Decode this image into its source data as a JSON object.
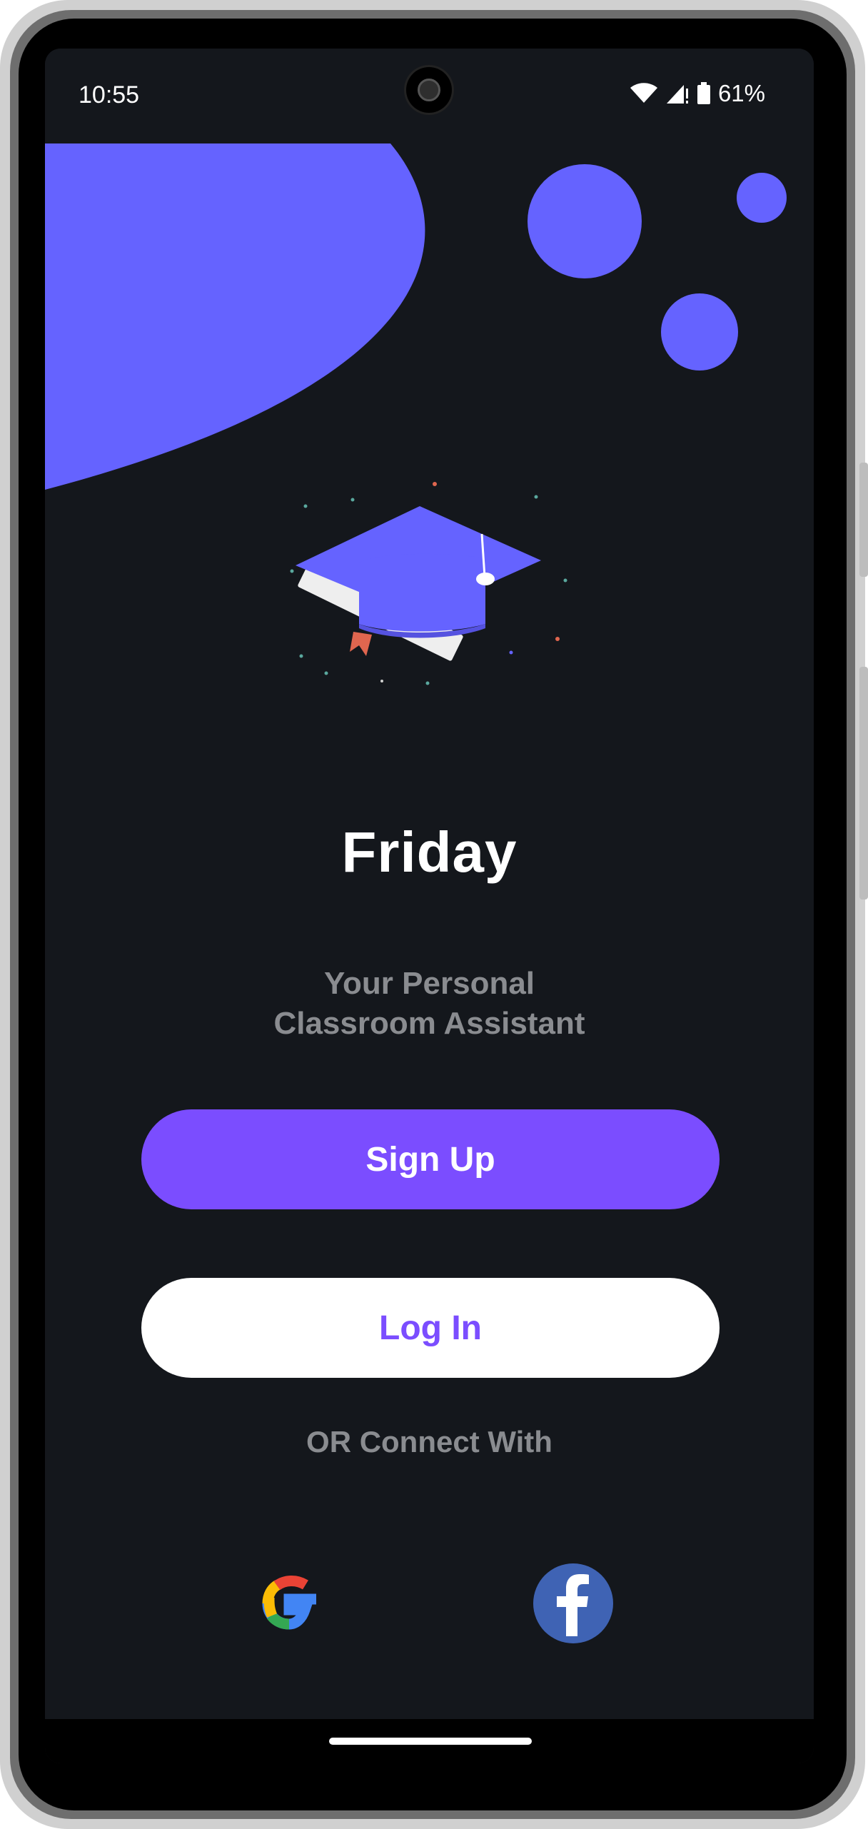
{
  "status_bar": {
    "time": "10:55",
    "battery_text": "61%",
    "icons": [
      "wifi-icon",
      "signal-icon",
      "battery-icon"
    ]
  },
  "app": {
    "title": "Friday",
    "subtitle_line1": "Your Personal",
    "subtitle_line2": "Classroom Assistant"
  },
  "buttons": {
    "signup_label": "Sign Up",
    "login_label": "Log In"
  },
  "social": {
    "connect_text": "OR Connect With",
    "providers": [
      "google-icon",
      "facebook-icon"
    ]
  },
  "colors": {
    "background": "#14171c",
    "accent": "#7b4dff",
    "decor": "#6563ff",
    "muted_text": "#8a8c90"
  }
}
